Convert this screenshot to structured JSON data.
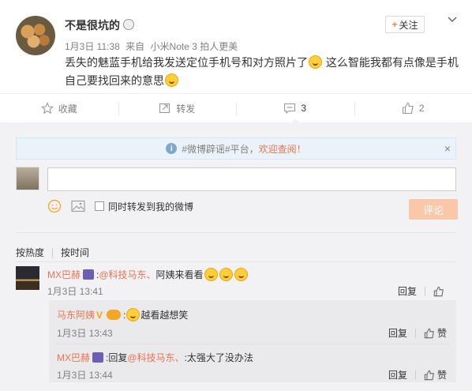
{
  "post": {
    "username": "不是很坑的",
    "date": "1月3日 11:38",
    "source_prefix": "来自",
    "source": "小米Note 3 拍人更美",
    "content_1": "丢失的魅蓝手机给我发送定位手机号和对方照片了",
    "content_2": " 这么智能我都有点像是手机自己要找回来的意思",
    "follow_label": "关注",
    "follow_plus": "+"
  },
  "actions": {
    "collect": "收藏",
    "repost": "转发",
    "comment_count": "3",
    "like_count": "2"
  },
  "notice": {
    "text": "#微博辟谣#平台，",
    "link": "欢迎查阅！",
    "close": "×",
    "info": "i"
  },
  "composer": {
    "also_repost": "同时转发到我的微博",
    "submit": "评论",
    "input_value": ""
  },
  "sort": {
    "hot": "按热度",
    "time": "按时间"
  },
  "comments": [
    {
      "user": "MX巴赫",
      "at": "@科技马东、",
      "text": " 阿姨来看看",
      "time": "1月3日 13:41",
      "reply_label": "回复",
      "like_label": ""
    }
  ],
  "replies": [
    {
      "user": "马东阿姨",
      "v": "V",
      "text": "越看越想笑",
      "time": "1月3日 13:43",
      "reply_label": "回复",
      "like_label": "赞"
    },
    {
      "user": "MX巴赫",
      "prefix": ":回复",
      "at": "@科技马东、",
      "text": ":太强大了没办法",
      "time": "1月3日 13:44",
      "reply_label": "回复",
      "like_label": "赞"
    }
  ],
  "colors": {
    "accent": "#eb7350",
    "submit_disabled": "#fbc7a9",
    "comment_bg": "#f2f2f5"
  },
  "icons": [
    "star-icon",
    "repost-icon",
    "comment-icon",
    "like-icon",
    "emoji-icon",
    "image-icon",
    "info-icon",
    "close-icon",
    "chevron-down-icon"
  ]
}
